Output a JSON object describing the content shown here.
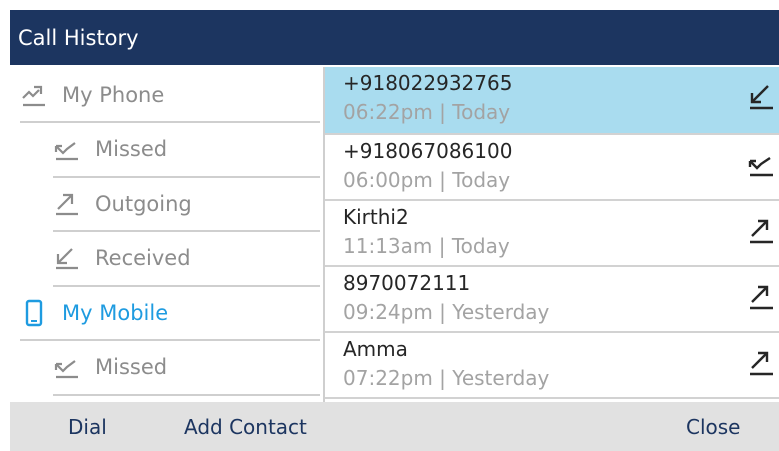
{
  "header": {
    "title": "Call History"
  },
  "menu": [
    {
      "label": "My Phone",
      "icon": "phone-calls-icon",
      "active": false
    },
    {
      "label": "Missed",
      "icon": "missed-call-icon",
      "active": false
    },
    {
      "label": "Outgoing",
      "icon": "outgoing-call-icon",
      "active": false
    },
    {
      "label": "Received",
      "icon": "received-call-icon",
      "active": false
    },
    {
      "label": "My Mobile",
      "icon": "mobile-phone-icon",
      "active": true
    },
    {
      "label": "Missed",
      "icon": "missed-call-icon",
      "active": false
    }
  ],
  "calls": [
    {
      "name": "+918022932765",
      "meta": "06:22pm | Today",
      "type": "received-call-icon",
      "selected": true
    },
    {
      "name": "+918067086100",
      "meta": "06:00pm | Today",
      "type": "missed-call-icon",
      "selected": false
    },
    {
      "name": "Kirthi2",
      "meta": "11:13am | Today",
      "type": "outgoing-call-icon",
      "selected": false
    },
    {
      "name": "8970072111",
      "meta": "09:24pm | Yesterday",
      "type": "outgoing-call-icon",
      "selected": false
    },
    {
      "name": "Amma",
      "meta": "07:22pm | Yesterday",
      "type": "outgoing-call-icon",
      "selected": false
    }
  ],
  "softkeys": {
    "dial": "Dial",
    "add_contact": "Add Contact",
    "close": "Close"
  },
  "colors": {
    "header_bg": "#1c3560",
    "selected_row": "#a9dcef",
    "active_accent": "#1e9be0",
    "softkey_bar": "#e1e1e1",
    "menu_text": "#8c8c8c"
  }
}
